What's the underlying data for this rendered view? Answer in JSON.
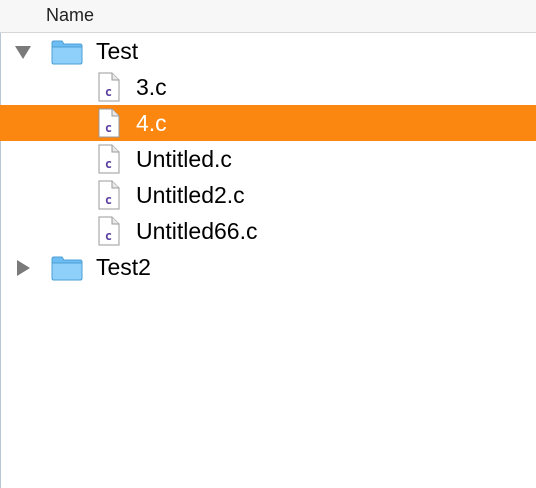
{
  "outline": {
    "column_header": "Name",
    "accent_selection_color": "#fb8710",
    "tree": [
      {
        "label": "Test",
        "type": "folder",
        "expanded": true,
        "children": [
          {
            "label": "3.c",
            "type": "file",
            "selected": false
          },
          {
            "label": "4.c",
            "type": "file",
            "selected": true
          },
          {
            "label": "Untitled.c",
            "type": "file",
            "selected": false
          },
          {
            "label": "Untitled2.c",
            "type": "file",
            "selected": false
          },
          {
            "label": "Untitled66.c",
            "type": "file",
            "selected": false
          }
        ]
      },
      {
        "label": "Test2",
        "type": "folder",
        "expanded": false,
        "children": []
      }
    ]
  },
  "icons": {
    "folder": "folder-icon",
    "file": "c-source-file-icon",
    "expanded": "disclosure-triangle-down-icon",
    "collapsed": "disclosure-triangle-right-icon"
  }
}
